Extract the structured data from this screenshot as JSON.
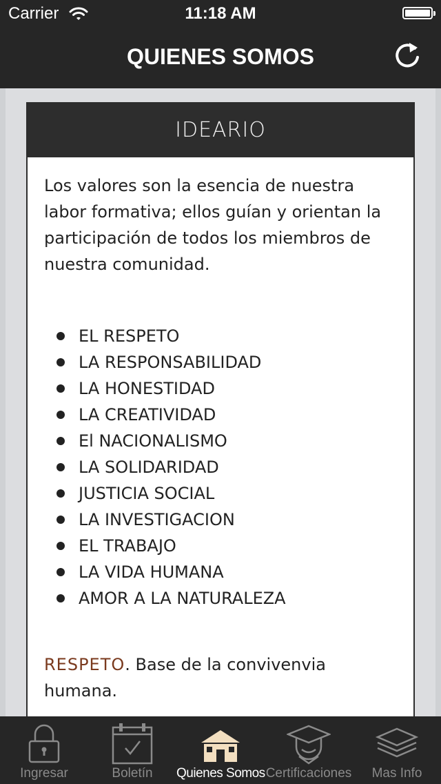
{
  "status_bar": {
    "carrier": "Carrier",
    "time": "11:18 AM"
  },
  "nav": {
    "title": "QUIENES SOMOS",
    "refresh_icon": "refresh-icon"
  },
  "card": {
    "header": "IDEARIO",
    "intro": "Los valores son la esencia de nuestra labor formativa; ellos guían y orientan la participación de todos los miembros de nuestra comunidad.",
    "values": [
      "EL RESPETO",
      "LA RESPONSABILIDAD",
      "LA HONESTIDAD",
      "LA CREATIVIDAD",
      "El NACIONALISMO",
      "LA SOLIDARIDAD",
      "JUSTICIA SOCIAL",
      "LA INVESTIGACION",
      "EL TRABAJO",
      "LA VIDA HUMANA",
      "AMOR A LA NATURALEZA"
    ],
    "respeto_keyword": "RESPETO",
    "respeto_text": ". Base de la convivenvia humana."
  },
  "tabs": [
    {
      "label": "Ingresar",
      "icon": "lock-icon",
      "active": false
    },
    {
      "label": "Boletín",
      "icon": "calendar-icon",
      "active": false
    },
    {
      "label": "Quienes Somos",
      "icon": "building-icon",
      "active": true
    },
    {
      "label": "Certificaciones",
      "icon": "graduate-icon",
      "active": false
    },
    {
      "label": "Mas Info",
      "icon": "layers-icon",
      "active": false
    }
  ],
  "colors": {
    "bar": "#262626",
    "card_header": "#2d2d2d",
    "accent": "#7a3a1e",
    "active_tab_icon": "#f3dfc0",
    "inactive_tab": "#8a8a8a"
  }
}
